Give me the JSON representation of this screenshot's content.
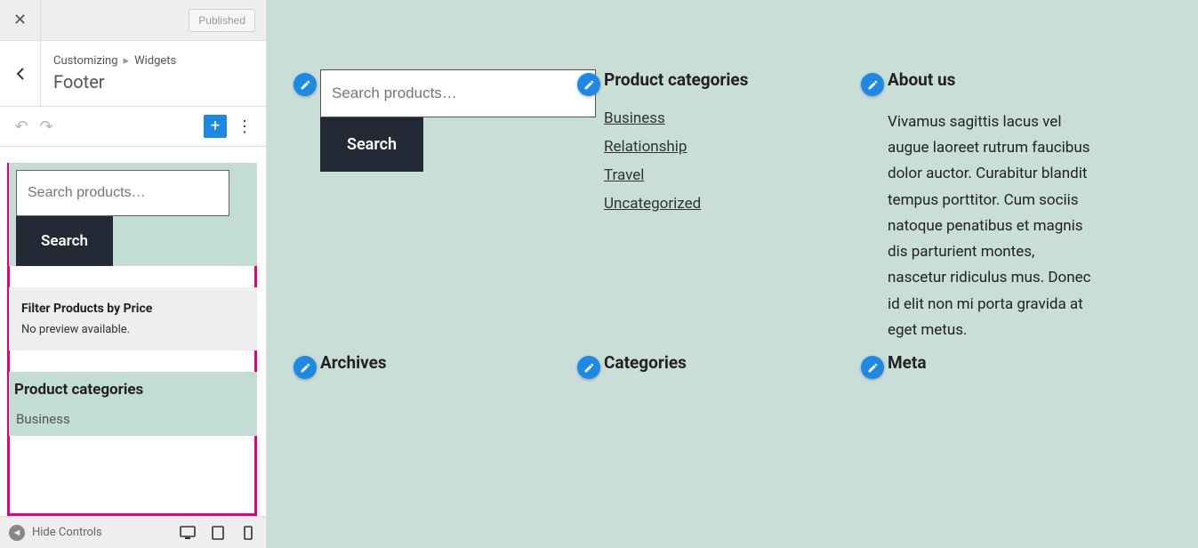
{
  "header": {
    "published_label": "Published",
    "breadcrumb_parent": "Customizing",
    "breadcrumb_child": "Widgets",
    "section_title": "Footer"
  },
  "toolbar": {
    "add_label": "+",
    "hide_controls_label": "Hide Controls"
  },
  "panel_blocks": {
    "search": {
      "placeholder": "Search products…",
      "button": "Search"
    },
    "filter": {
      "title": "Filter Products by Price",
      "message": "No preview available."
    },
    "categories": {
      "title": "Product categories",
      "first_item": "Business"
    }
  },
  "preview": {
    "search": {
      "placeholder": "Search products…",
      "button": "Search"
    },
    "product_categories": {
      "title": "Product categories",
      "items": [
        "Business",
        "Relationship",
        "Travel",
        "Uncategorized"
      ]
    },
    "about": {
      "title": "About us",
      "body": "Vivamus sagittis lacus vel augue laoreet rutrum faucibus dolor auctor. Curabitur blandit tempus porttitor. Cum sociis natoque penatibus et magnis dis parturient montes, nascetur ridiculus mus. Donec id elit non mi porta gravida at eget metus."
    },
    "row2": {
      "archives": "Archives",
      "categories": "Categories",
      "meta": "Meta"
    }
  }
}
